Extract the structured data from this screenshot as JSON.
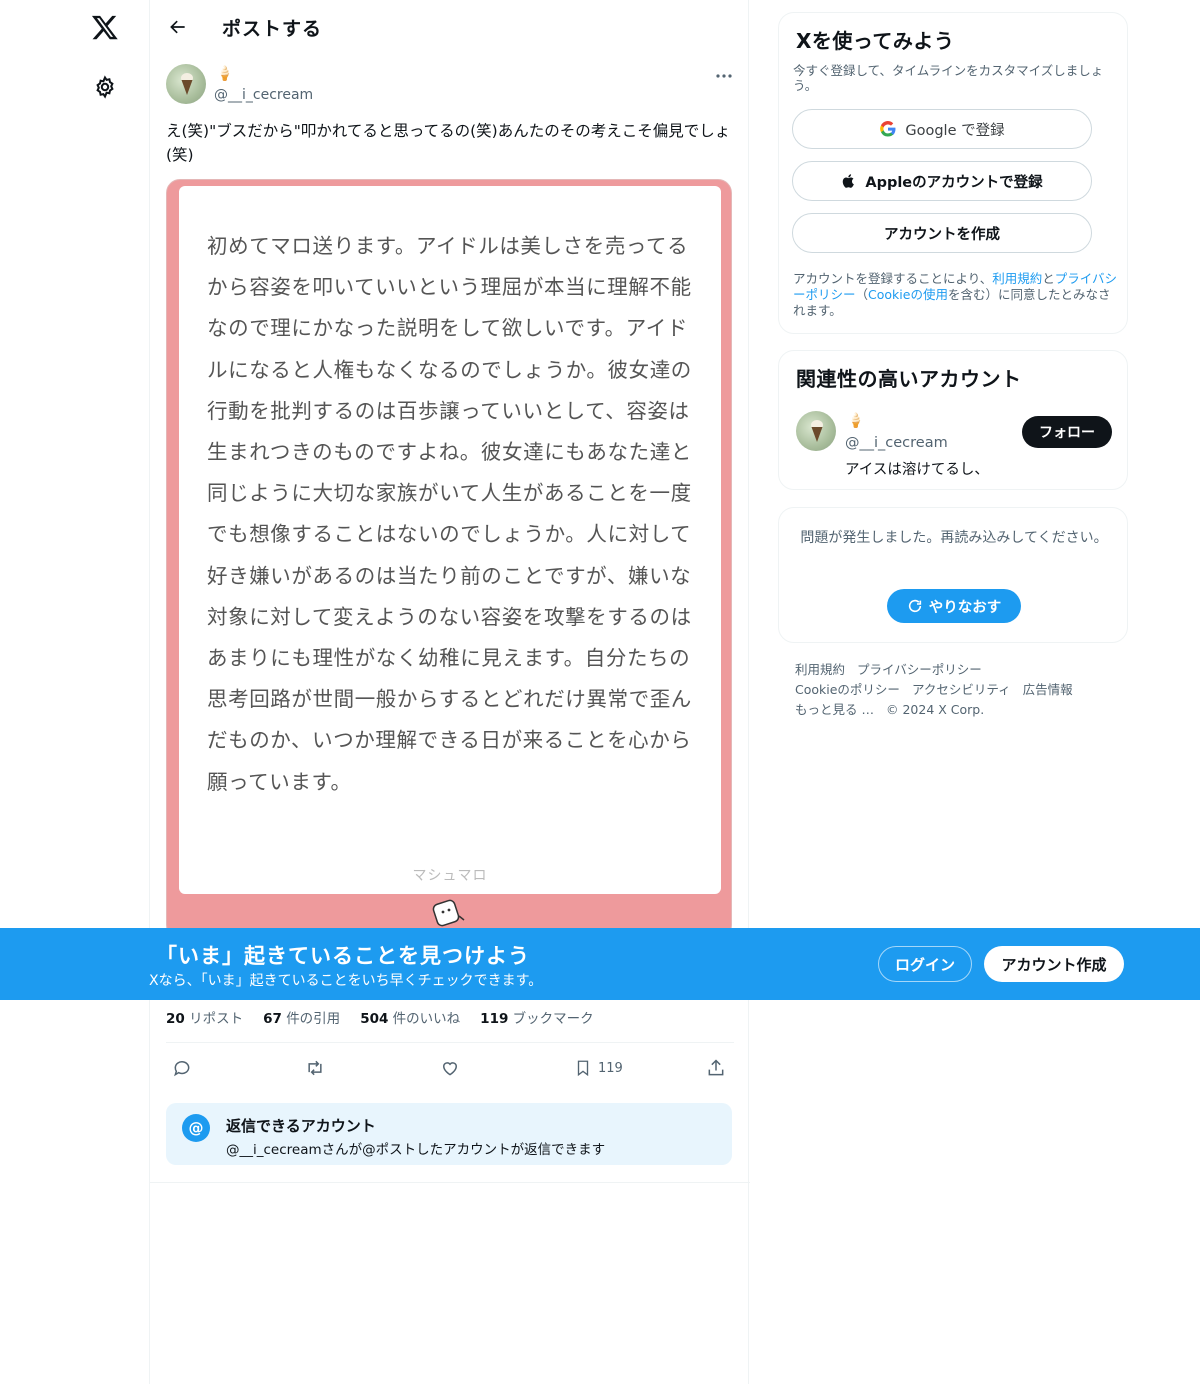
{
  "nav": {
    "logo_icon": "x-logo-icon",
    "settings_icon": "gear-icon"
  },
  "header": {
    "title": "ポストする",
    "back_icon": "arrow-left-icon"
  },
  "post": {
    "name_emoji": "🍦",
    "handle": "@__i_cecream",
    "text": "え(笑)\"ブスだから\"叩かれてると思ってるの(笑)あんたのその考えこそ偏見でしょ(笑)",
    "card_text": "初めてマロ送ります。アイドルは美しさを売ってるから容姿を叩いていいという理屈が本当に理解不能なので理にかなった説明をして欲しいです。アイドルになると人権もなくなるのでしょうか。彼女達の行動を批判するのは百歩譲っていいとして、容姿は生まれつきのものですよね。彼女達にもあなた達と同じように大切な家族がいて人生があることを一度でも想像することはないのでしょうか。人に対して好き嫌いがあるのは当たり前のことですが、嫌いな対象に対して変えようのない容姿を攻撃をするのはあまりにも理性がなく幼稚に見えます。自分たちの思考回路が世間一般からするとどれだけ異常で歪んだものか、いつか理解できる日が来ることを心から願っています。",
    "card_brand": "マシュマロ",
    "card_color": "#ee9a9c",
    "stats": {
      "reposts_count": "20",
      "reposts_label": "リポスト",
      "quotes_count": "67",
      "quotes_label": "件の引用",
      "likes_count": "504",
      "likes_label": "件のいいね",
      "bookmarks_count": "119",
      "bookmarks_label": "ブックマーク"
    },
    "actions": {
      "bookmark_count": "119"
    },
    "reply_restriction": {
      "title": "返信できるアカウント",
      "subtitle": "@__i_cecreamさんが@ポストしたアカウントが返信できます",
      "icon_text": "@"
    }
  },
  "banner": {
    "title": "「いま」起きていることを見つけよう",
    "subtitle": "Xなら、「いま」起きていることをいち早くチェックできます。",
    "login_label": "ログイン",
    "signup_label": "アカウント作成",
    "color": "#1d9bf0"
  },
  "signup_panel": {
    "title": "Xを使ってみよう",
    "subtitle": "今すぐ登録して、タイムラインをカスタマイズしましょう。",
    "google_label": "Google で登録",
    "apple_label": "Appleのアカウントで登録",
    "create_label": "アカウントを作成",
    "legal_prefix": "アカウントを登録することにより、",
    "legal_terms": "利用規約",
    "legal_and": "と",
    "legal_privacy": "プライバシーポリシー",
    "legal_paren_open": "（",
    "legal_cookie": "Cookieの使用",
    "legal_suffix": "を含む）に同意したとみなされます。"
  },
  "relevant_panel": {
    "title": "関連性の高いアカウント",
    "name_emoji": "🍦",
    "handle": "@__i_cecream",
    "bio": "アイスは溶けてるし、",
    "follow_label": "フォロー"
  },
  "error_panel": {
    "message": "問題が発生しました。再読み込みしてください。",
    "retry_label": "やりなおす"
  },
  "footer": {
    "links": [
      "利用規約",
      "プライバシーポリシー",
      "Cookieのポリシー",
      "アクセシビリティ",
      "広告情報",
      "もっと見る …",
      "© 2024 X Corp."
    ]
  }
}
